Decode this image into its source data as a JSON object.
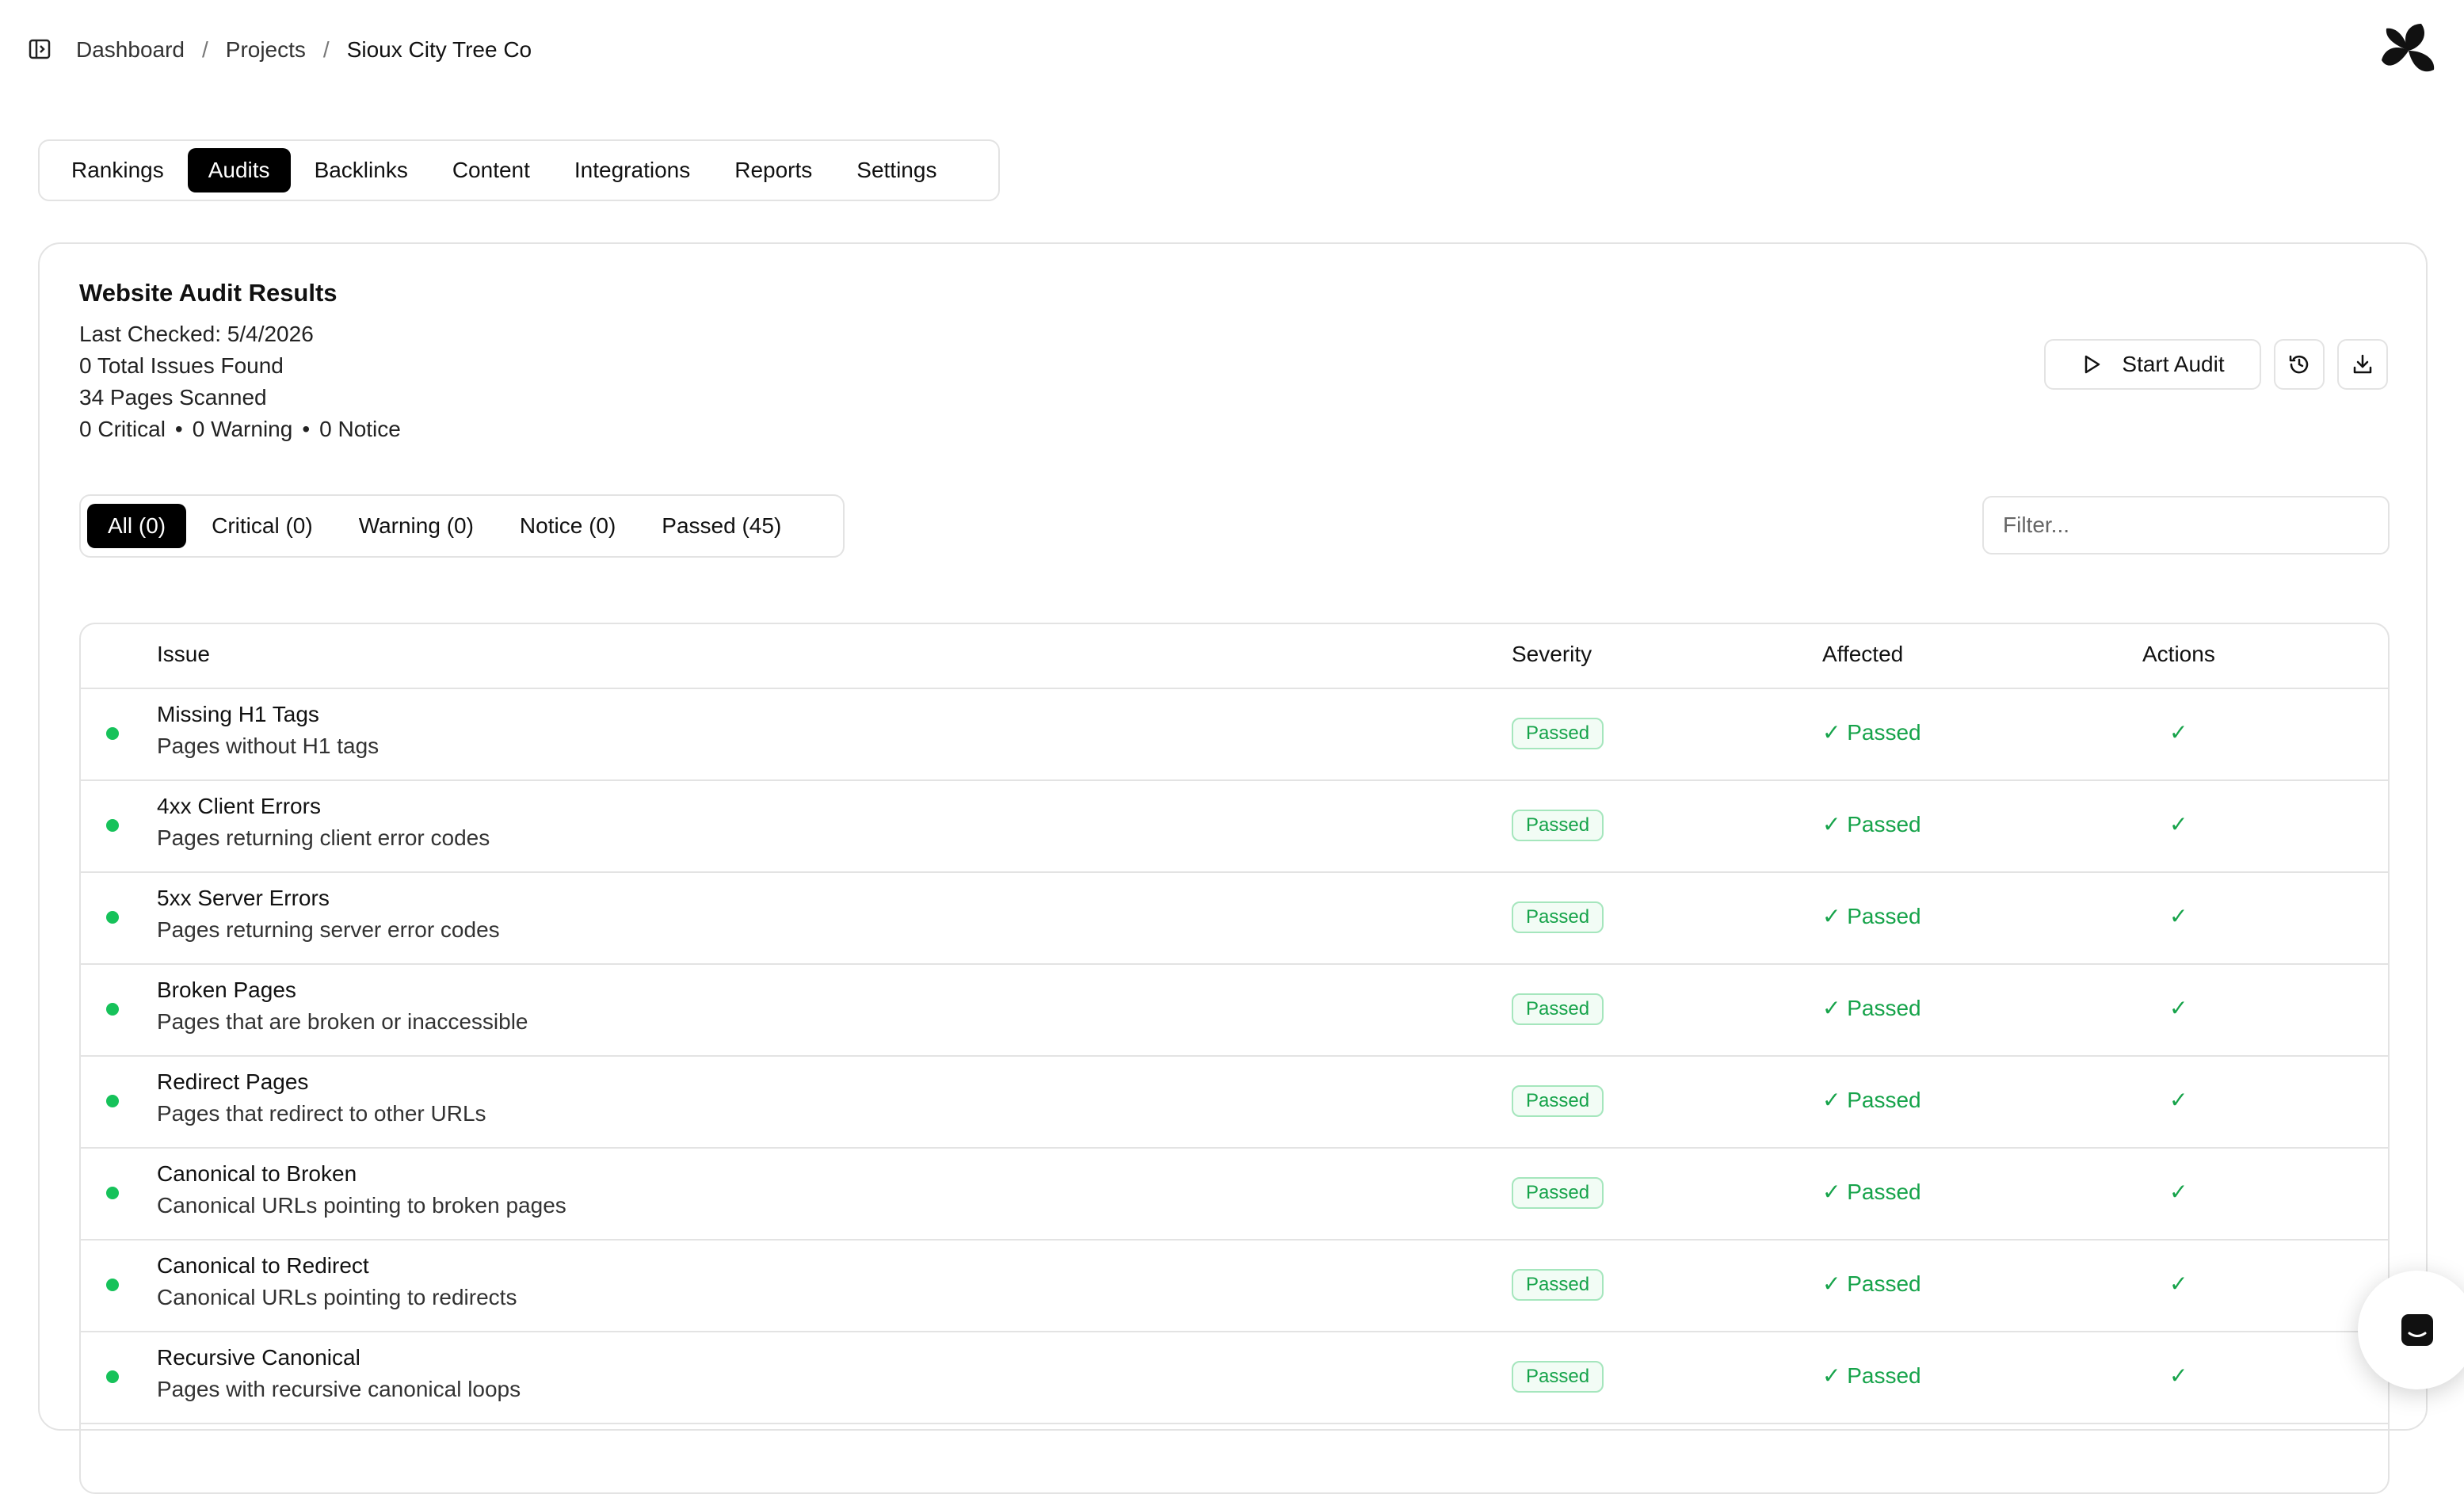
{
  "breadcrumb": [
    "Dashboard",
    "Projects",
    "Sioux City Tree Co"
  ],
  "breadcrumb_separator": "/",
  "nav_tabs": [
    "Rankings",
    "Audits",
    "Backlinks",
    "Content",
    "Integrations",
    "Reports",
    "Settings"
  ],
  "nav_active": "Audits",
  "audit": {
    "title": "Website Audit Results",
    "last_checked": "Last Checked: 5/4/2026",
    "total_issues": "0 Total Issues Found",
    "pages_scanned": "34 Pages Scanned",
    "critical": "0 Critical",
    "warning": "0 Warning",
    "notice": "0 Notice",
    "dot": "•",
    "start_label": "Start Audit"
  },
  "filter_tabs": [
    "All (0)",
    "Critical (0)",
    "Warning (0)",
    "Notice (0)",
    "Passed (45)"
  ],
  "filter_active": "All (0)",
  "filter_placeholder": "Filter...",
  "table": {
    "headers": {
      "issue": "Issue",
      "severity": "Severity",
      "affected": "Affected",
      "actions": "Actions"
    },
    "rows": [
      {
        "title": "Missing H1 Tags",
        "desc": "Pages without H1 tags",
        "severity": "Passed",
        "affected": "✓ Passed",
        "action": "✓"
      },
      {
        "title": "4xx Client Errors",
        "desc": "Pages returning client error codes",
        "severity": "Passed",
        "affected": "✓ Passed",
        "action": "✓"
      },
      {
        "title": "5xx Server Errors",
        "desc": "Pages returning server error codes",
        "severity": "Passed",
        "affected": "✓ Passed",
        "action": "✓"
      },
      {
        "title": "Broken Pages",
        "desc": "Pages that are broken or inaccessible",
        "severity": "Passed",
        "affected": "✓ Passed",
        "action": "✓"
      },
      {
        "title": "Redirect Pages",
        "desc": "Pages that redirect to other URLs",
        "severity": "Passed",
        "affected": "✓ Passed",
        "action": "✓"
      },
      {
        "title": "Canonical to Broken",
        "desc": "Canonical URLs pointing to broken pages",
        "severity": "Passed",
        "affected": "✓ Passed",
        "action": "✓"
      },
      {
        "title": "Canonical to Redirect",
        "desc": "Canonical URLs pointing to redirects",
        "severity": "Passed",
        "affected": "✓ Passed",
        "action": "✓"
      },
      {
        "title": "Recursive Canonical",
        "desc": "Pages with recursive canonical loops",
        "severity": "Passed",
        "affected": "✓ Passed",
        "action": "✓"
      }
    ]
  },
  "colors": {
    "accent": "#000000",
    "passed": "#16a34a",
    "dot": "#16c25a",
    "border": "#e3e3e3"
  },
  "icons": {
    "sidebar": "sidebar-toggle-icon",
    "logo": "pinwheel-logo",
    "start": "play-icon",
    "history": "history-icon",
    "download": "download-icon",
    "chat": "chat-icon"
  }
}
